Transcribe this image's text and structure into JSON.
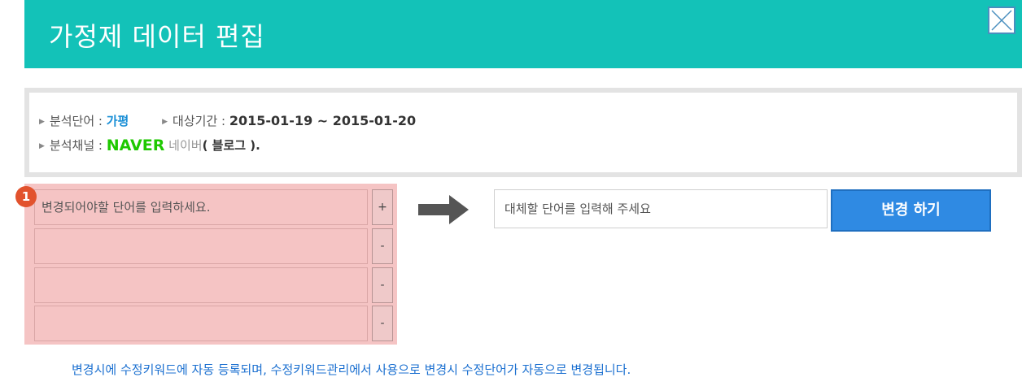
{
  "header": {
    "title": "가정제 데이터 편집",
    "close_icon": "close-icon"
  },
  "info": {
    "keyword_label": "분석단어 :",
    "keyword_value": "가평",
    "period_label": "대상기간 :",
    "period_value": "2015-01-19 ~ 2015-01-20",
    "channel_label": "분석채널 :",
    "channel_logo": "NAVER",
    "channel_name": "네이버",
    "channel_sub": "( 블로그 ).",
    "channel_color": "#1ec800"
  },
  "badge": "1",
  "word_inputs": [
    {
      "placeholder": "변경되어야할 단어를 입력하세요.",
      "button": "+"
    },
    {
      "placeholder": "",
      "button": "-"
    },
    {
      "placeholder": "",
      "button": "-"
    },
    {
      "placeholder": "",
      "button": "-"
    }
  ],
  "replace": {
    "placeholder": "대체할 단어를 입력해 주세요",
    "button_label": "변경 하기"
  },
  "footer_note": "변경시에 수정키워드에 자동 등록되며, 수정키워드관리에서 사용으로 변경시 수정단어가 자동으로 변경됩니다.",
  "colors": {
    "header": "#13c2b8",
    "button": "#2f8ae3",
    "highlight": "#f5c4c4",
    "badge": "#e2522d"
  }
}
